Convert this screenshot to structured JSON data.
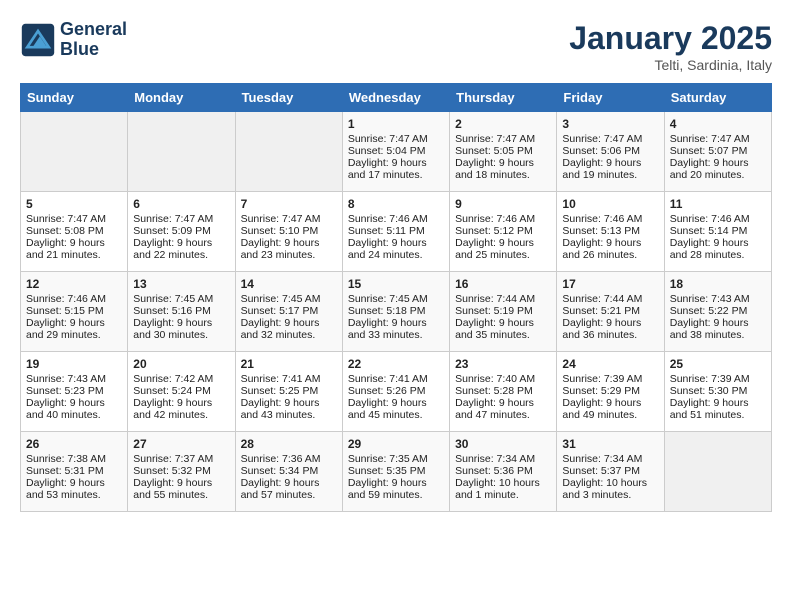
{
  "header": {
    "logo_line1": "General",
    "logo_line2": "Blue",
    "month": "January 2025",
    "location": "Telti, Sardinia, Italy"
  },
  "days_of_week": [
    "Sunday",
    "Monday",
    "Tuesday",
    "Wednesday",
    "Thursday",
    "Friday",
    "Saturday"
  ],
  "weeks": [
    [
      {
        "day": "",
        "info": ""
      },
      {
        "day": "",
        "info": ""
      },
      {
        "day": "",
        "info": ""
      },
      {
        "day": "1",
        "info": "Sunrise: 7:47 AM\nSunset: 5:04 PM\nDaylight: 9 hours\nand 17 minutes."
      },
      {
        "day": "2",
        "info": "Sunrise: 7:47 AM\nSunset: 5:05 PM\nDaylight: 9 hours\nand 18 minutes."
      },
      {
        "day": "3",
        "info": "Sunrise: 7:47 AM\nSunset: 5:06 PM\nDaylight: 9 hours\nand 19 minutes."
      },
      {
        "day": "4",
        "info": "Sunrise: 7:47 AM\nSunset: 5:07 PM\nDaylight: 9 hours\nand 20 minutes."
      }
    ],
    [
      {
        "day": "5",
        "info": "Sunrise: 7:47 AM\nSunset: 5:08 PM\nDaylight: 9 hours\nand 21 minutes."
      },
      {
        "day": "6",
        "info": "Sunrise: 7:47 AM\nSunset: 5:09 PM\nDaylight: 9 hours\nand 22 minutes."
      },
      {
        "day": "7",
        "info": "Sunrise: 7:47 AM\nSunset: 5:10 PM\nDaylight: 9 hours\nand 23 minutes."
      },
      {
        "day": "8",
        "info": "Sunrise: 7:46 AM\nSunset: 5:11 PM\nDaylight: 9 hours\nand 24 minutes."
      },
      {
        "day": "9",
        "info": "Sunrise: 7:46 AM\nSunset: 5:12 PM\nDaylight: 9 hours\nand 25 minutes."
      },
      {
        "day": "10",
        "info": "Sunrise: 7:46 AM\nSunset: 5:13 PM\nDaylight: 9 hours\nand 26 minutes."
      },
      {
        "day": "11",
        "info": "Sunrise: 7:46 AM\nSunset: 5:14 PM\nDaylight: 9 hours\nand 28 minutes."
      }
    ],
    [
      {
        "day": "12",
        "info": "Sunrise: 7:46 AM\nSunset: 5:15 PM\nDaylight: 9 hours\nand 29 minutes."
      },
      {
        "day": "13",
        "info": "Sunrise: 7:45 AM\nSunset: 5:16 PM\nDaylight: 9 hours\nand 30 minutes."
      },
      {
        "day": "14",
        "info": "Sunrise: 7:45 AM\nSunset: 5:17 PM\nDaylight: 9 hours\nand 32 minutes."
      },
      {
        "day": "15",
        "info": "Sunrise: 7:45 AM\nSunset: 5:18 PM\nDaylight: 9 hours\nand 33 minutes."
      },
      {
        "day": "16",
        "info": "Sunrise: 7:44 AM\nSunset: 5:19 PM\nDaylight: 9 hours\nand 35 minutes."
      },
      {
        "day": "17",
        "info": "Sunrise: 7:44 AM\nSunset: 5:21 PM\nDaylight: 9 hours\nand 36 minutes."
      },
      {
        "day": "18",
        "info": "Sunrise: 7:43 AM\nSunset: 5:22 PM\nDaylight: 9 hours\nand 38 minutes."
      }
    ],
    [
      {
        "day": "19",
        "info": "Sunrise: 7:43 AM\nSunset: 5:23 PM\nDaylight: 9 hours\nand 40 minutes."
      },
      {
        "day": "20",
        "info": "Sunrise: 7:42 AM\nSunset: 5:24 PM\nDaylight: 9 hours\nand 42 minutes."
      },
      {
        "day": "21",
        "info": "Sunrise: 7:41 AM\nSunset: 5:25 PM\nDaylight: 9 hours\nand 43 minutes."
      },
      {
        "day": "22",
        "info": "Sunrise: 7:41 AM\nSunset: 5:26 PM\nDaylight: 9 hours\nand 45 minutes."
      },
      {
        "day": "23",
        "info": "Sunrise: 7:40 AM\nSunset: 5:28 PM\nDaylight: 9 hours\nand 47 minutes."
      },
      {
        "day": "24",
        "info": "Sunrise: 7:39 AM\nSunset: 5:29 PM\nDaylight: 9 hours\nand 49 minutes."
      },
      {
        "day": "25",
        "info": "Sunrise: 7:39 AM\nSunset: 5:30 PM\nDaylight: 9 hours\nand 51 minutes."
      }
    ],
    [
      {
        "day": "26",
        "info": "Sunrise: 7:38 AM\nSunset: 5:31 PM\nDaylight: 9 hours\nand 53 minutes."
      },
      {
        "day": "27",
        "info": "Sunrise: 7:37 AM\nSunset: 5:32 PM\nDaylight: 9 hours\nand 55 minutes."
      },
      {
        "day": "28",
        "info": "Sunrise: 7:36 AM\nSunset: 5:34 PM\nDaylight: 9 hours\nand 57 minutes."
      },
      {
        "day": "29",
        "info": "Sunrise: 7:35 AM\nSunset: 5:35 PM\nDaylight: 9 hours\nand 59 minutes."
      },
      {
        "day": "30",
        "info": "Sunrise: 7:34 AM\nSunset: 5:36 PM\nDaylight: 10 hours\nand 1 minute."
      },
      {
        "day": "31",
        "info": "Sunrise: 7:34 AM\nSunset: 5:37 PM\nDaylight: 10 hours\nand 3 minutes."
      },
      {
        "day": "",
        "info": ""
      }
    ]
  ]
}
